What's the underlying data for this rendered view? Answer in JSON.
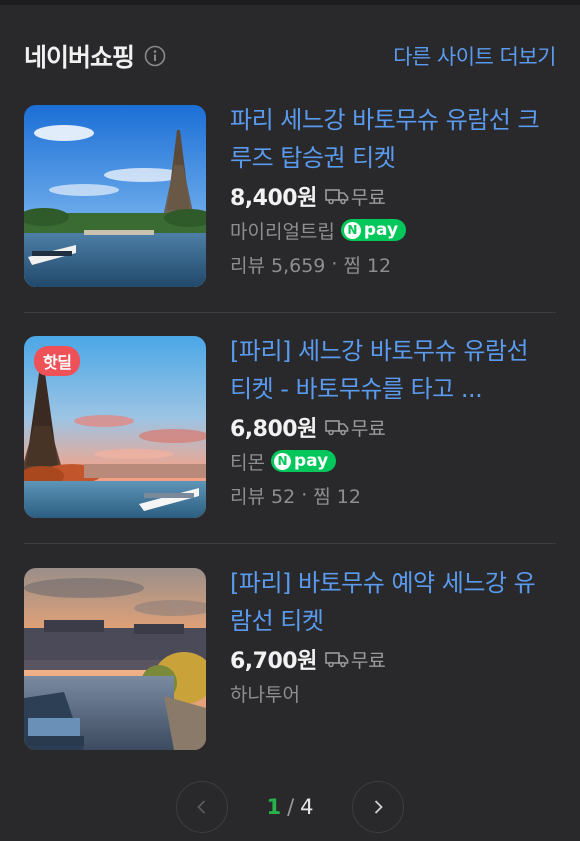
{
  "header": {
    "title": "네이버쇼핑",
    "more_link": "다른 사이트 더보기"
  },
  "products": [
    {
      "title": "파리 세느강 바토무슈 유람선 크루즈 탑승권 티켓",
      "price": "8,400원",
      "shipping": "무료",
      "seller": "마이리얼트립",
      "npay": "pay",
      "reviews": "리뷰 5,659",
      "likes": "찜 12"
    },
    {
      "badge": "핫딜",
      "title": "[파리] 세느강 바토무슈 유람선 티켓 - 바토무슈를 타고 ...",
      "price": "6,800원",
      "shipping": "무료",
      "seller": "티몬",
      "npay": "pay",
      "reviews": "리뷰 52",
      "likes": "찜 12"
    },
    {
      "title": "[파리] 바토무슈 예약 세느강 유람선 티켓",
      "price": "6,700원",
      "shipping": "무료",
      "seller": "하나투어"
    }
  ],
  "pagination": {
    "current": "1",
    "separator": "/",
    "total": "4"
  },
  "colors": {
    "background": "#29292b",
    "link": "#5a9bef",
    "npay": "#03c75a",
    "hotdeal": "#ee5157",
    "current_page": "#27b24c"
  }
}
